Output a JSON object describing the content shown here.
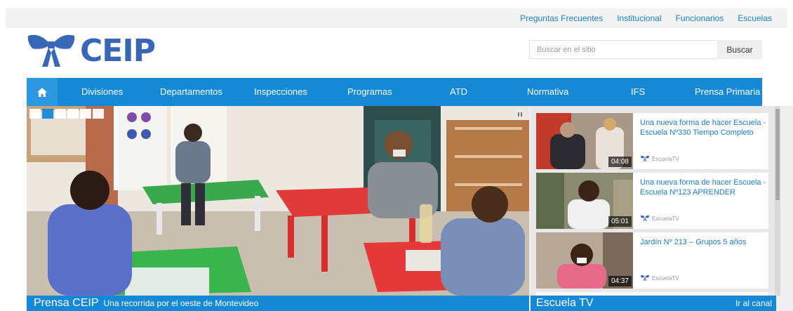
{
  "top_links": [
    "Preguntas Frecuentes",
    "Institucional",
    "Funcionarios",
    "Escuelas"
  ],
  "logo": {
    "text": "CEIP",
    "color": "#3867b8"
  },
  "search": {
    "placeholder": "Buscar en el sitio",
    "button": "Buscar"
  },
  "nav": {
    "home_icon": "home-icon",
    "items": [
      "Divisiones",
      "Departamentos",
      "Inspecciones",
      "Programas",
      "ATD",
      "Normativa",
      "IFS",
      "Prensa Primaria"
    ],
    "color": "#1588d6"
  },
  "hero": {
    "section": "Prensa CEIP",
    "caption": "Una recorrida por el oeste de Montevideo",
    "slides": 6,
    "active_slide": 2
  },
  "tv": {
    "section": "Escuela TV",
    "link": "Ir al canal",
    "brand": "EscuelaTV",
    "videos": [
      {
        "title": "Una nueva forma de hacer Escuela - Escuela Nº330 Tiempo Completo",
        "duration": "04:08"
      },
      {
        "title": "Una nueva forma de hacer Escuela - Escuela Nº123 APRENDER",
        "duration": "05:01"
      },
      {
        "title": "Jardín Nº 213 – Grupos 5 años",
        "duration": "04:37"
      }
    ]
  }
}
